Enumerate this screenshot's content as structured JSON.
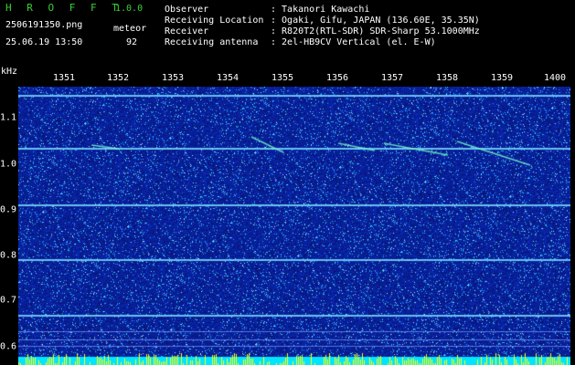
{
  "header": {
    "brand": "H R O F F T",
    "version": "1.0.0",
    "filename": "2506191350.png",
    "datetime": "25.06.19 13:50",
    "meteor_label": "meteor",
    "meteor_count": "92",
    "info": [
      {
        "label": "Observer",
        "value": ": Takanori Kawachi"
      },
      {
        "label": "Receiving Location",
        "value": ": Ogaki, Gifu, JAPAN (136.60E, 35.35N)"
      },
      {
        "label": "Receiver",
        "value": ": R820T2(RTL-SDR) SDR-Sharp 53.1000MHz"
      },
      {
        "label": "Receiving antenna",
        "value": ": 2el-HB9CV Vertical (el. E-W)"
      }
    ]
  },
  "axes": {
    "y_unit": "kHz",
    "x_ticks": [
      "1351",
      "1352",
      "1353",
      "1354",
      "1355",
      "1356",
      "1357",
      "1358",
      "1359",
      "1400"
    ],
    "y_ticks": [
      "1.1",
      "1.0",
      "0.9",
      "0.8",
      "0.7",
      "0.6"
    ]
  },
  "colors": {
    "background": "#000000",
    "noise_low": "#0a1a8c",
    "noise_high": "#2050ff",
    "carrier": "#7fd0ff",
    "bottom_band": "#00e5ff",
    "bottom_spikes": "#ffff00"
  }
}
